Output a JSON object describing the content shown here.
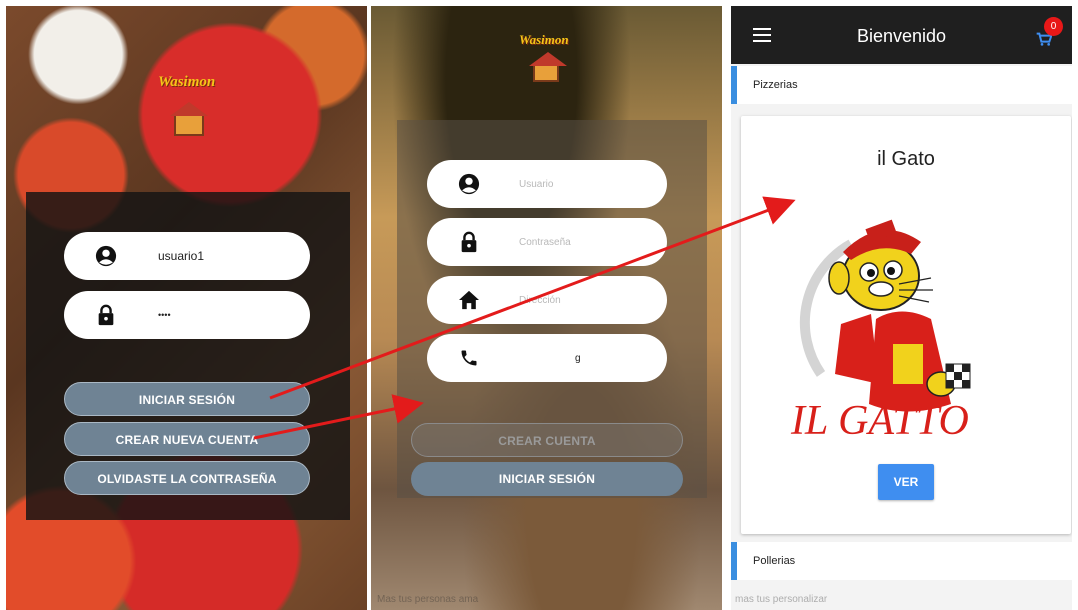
{
  "screen1": {
    "logo_text": "Wasimon",
    "username_value": "usuario1",
    "password_value": "••••",
    "login_button": "INICIAR SESIÓN",
    "create_account_button": "CREAR NUEVA CUENTA",
    "forgot_password_button": "OLVIDASTE LA CONTRASEÑA"
  },
  "screen2": {
    "logo_text": "Wasimon",
    "username_placeholder": "Usuario",
    "password_placeholder": "Contraseña",
    "address_placeholder": "Dirección",
    "phone_value": "g",
    "create_account_button": "CREAR CUENTA",
    "login_button": "INICIAR SESIÓN",
    "footer_text": "Mas tus personas ama"
  },
  "screen3": {
    "appbar_title": "Bienvenido",
    "cart_count": "0",
    "section1": "Pizzerias",
    "card_title": "il Gato",
    "card_logo_text": "IL GATTO",
    "ver_button": "VER",
    "section2": "Pollerias",
    "footer_text": "mas tus personalizar"
  },
  "icons": [
    "user-circle-icon",
    "lock-icon",
    "home-icon",
    "phone-icon",
    "menu-icon",
    "cart-icon"
  ],
  "colors": {
    "arrow": "#e31b1b",
    "primary_blue": "#3f8ef0",
    "section_accent": "#3a8ee0",
    "button_slate": "#6f8394"
  }
}
